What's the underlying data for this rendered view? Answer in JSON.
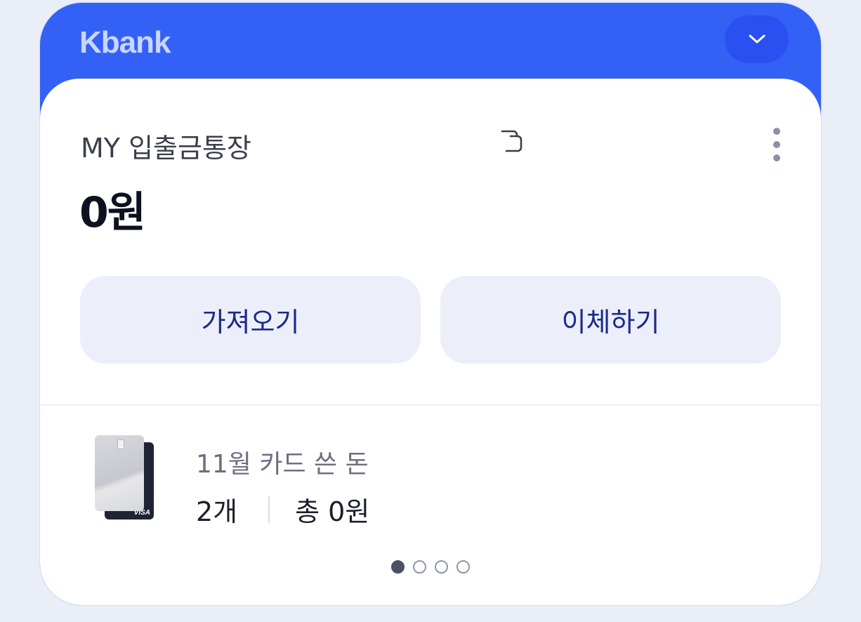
{
  "brand": "Kbank",
  "icons": {
    "toggle": "chevron-down-icon",
    "copy": "copy-icon",
    "more": "more-vertical-icon"
  },
  "colors": {
    "header_blue": "#3461f5",
    "toggle_blue": "#2a50f2",
    "button_bg": "#eceff9",
    "button_text": "#1a2a8c"
  },
  "account": {
    "name": "MY 입출금통장",
    "balance": "0원"
  },
  "actions": {
    "fetch_label": "가져오기",
    "transfer_label": "이체하기"
  },
  "card_spending": {
    "month_label": "11월 카드 쓴 돈",
    "count": "2개",
    "total": "총 0원",
    "card_brand": "VISA"
  },
  "pagination": {
    "total_pages": 4,
    "current_page": 1
  }
}
